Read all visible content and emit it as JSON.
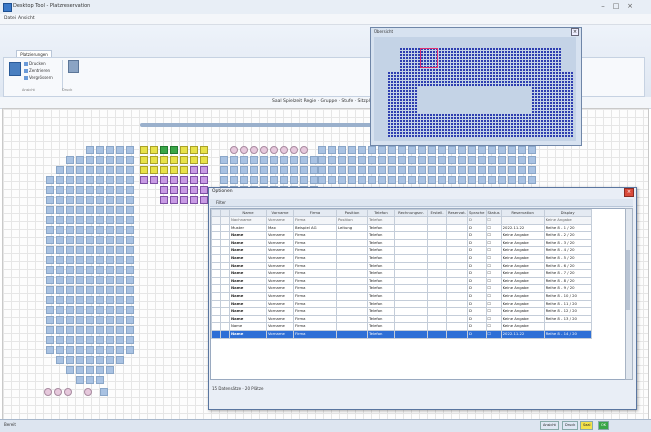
{
  "window": {
    "title": "Desktop Tool - Platzreservation",
    "controls": [
      "–",
      "□",
      "×"
    ]
  },
  "menu": {
    "items": [
      "Datei",
      "Ansicht"
    ]
  },
  "ribbon": {
    "tab": "Platzierungen",
    "small_buttons": [
      "Drucken",
      "Zentrieren",
      "Vergrössern"
    ],
    "groups": [
      "Ansicht",
      "Druck"
    ]
  },
  "strip": {
    "text": "Saal Spielzeit Regie · Gruppe · Stufe · Sitzplätze"
  },
  "overview": {
    "title": "Übersicht",
    "close": "×"
  },
  "dialog": {
    "title": "Optionen",
    "close": "×",
    "toolbar_label": "Filter",
    "columns": [
      "",
      "",
      "Name",
      "Vorname",
      "Firma",
      "Position",
      "Telefon",
      "Rechnungsnr.",
      "Erstell.",
      "Reservat.",
      "Sprache",
      "Status",
      "Reservation",
      "Display"
    ],
    "rows": [
      {
        "mark": "",
        "ico": "",
        "name": "Nachname",
        "vorname": "Vorname",
        "firma": "Firma",
        "position": "Position",
        "telefon": "Telefon",
        "r1": "",
        "r2": "",
        "r3": "",
        "sprache": "D",
        "status": "☐",
        "reservation": "",
        "display": "Keine Angabe",
        "bold": false,
        "filter": true
      },
      {
        "mark": "",
        "ico": "",
        "name": "Muster",
        "vorname": "Max",
        "firma": "Beispiel AG",
        "position": "Leitung",
        "telefon": "Telefon",
        "r1": "",
        "r2": "",
        "r3": "",
        "sprache": "D",
        "status": "☐",
        "reservation": "2022.11.22",
        "display": "Reihe 8 - 1 / 20",
        "bold": false,
        "filter": false
      },
      {
        "mark": "",
        "ico": "",
        "name": "Name",
        "vorname": "Vorname",
        "firma": "Firma",
        "position": "",
        "telefon": "Telefon",
        "r1": "",
        "r2": "",
        "r3": "",
        "sprache": "D",
        "status": "☐",
        "reservation": "Keine Angabe",
        "display": "Reihe 8 - 2 / 20",
        "bold": true,
        "filter": false
      },
      {
        "mark": "",
        "ico": "",
        "name": "Name",
        "vorname": "Vorname",
        "firma": "Firma",
        "position": "",
        "telefon": "Telefon",
        "r1": "",
        "r2": "",
        "r3": "",
        "sprache": "D",
        "status": "☐",
        "reservation": "Keine Angabe",
        "display": "Reihe 8 - 3 / 20",
        "bold": true,
        "filter": false
      },
      {
        "mark": "",
        "ico": "",
        "name": "Name",
        "vorname": "Vorname",
        "firma": "Firma",
        "position": "",
        "telefon": "Telefon",
        "r1": "",
        "r2": "",
        "r3": "",
        "sprache": "D",
        "status": "☐",
        "reservation": "Keine Angabe",
        "display": "Reihe 8 - 4 / 20",
        "bold": true,
        "filter": false
      },
      {
        "mark": "",
        "ico": "",
        "name": "Name",
        "vorname": "Vorname",
        "firma": "Firma",
        "position": "",
        "telefon": "Telefon",
        "r1": "",
        "r2": "",
        "r3": "",
        "sprache": "D",
        "status": "☐",
        "reservation": "Keine Angabe",
        "display": "Reihe 8 - 5 / 20",
        "bold": true,
        "filter": false
      },
      {
        "mark": "",
        "ico": "",
        "name": "Name",
        "vorname": "Vorname",
        "firma": "Firma",
        "position": "",
        "telefon": "Telefon",
        "r1": "",
        "r2": "",
        "r3": "",
        "sprache": "D",
        "status": "☐",
        "reservation": "Keine Angabe",
        "display": "Reihe 8 - 6 / 20",
        "bold": true,
        "filter": false
      },
      {
        "mark": "",
        "ico": "",
        "name": "Name",
        "vorname": "Vorname",
        "firma": "Firma",
        "position": "",
        "telefon": "Telefon",
        "r1": "",
        "r2": "",
        "r3": "",
        "sprache": "D",
        "status": "☐",
        "reservation": "Keine Angabe",
        "display": "Reihe 8 - 7 / 20",
        "bold": true,
        "filter": false
      },
      {
        "mark": "",
        "ico": "",
        "name": "Name",
        "vorname": "Vorname",
        "firma": "Firma",
        "position": "",
        "telefon": "Telefon",
        "r1": "",
        "r2": "",
        "r3": "",
        "sprache": "D",
        "status": "☐",
        "reservation": "Keine Angabe",
        "display": "Reihe 8 - 8 / 20",
        "bold": true,
        "filter": false
      },
      {
        "mark": "",
        "ico": "",
        "name": "Name",
        "vorname": "Vorname",
        "firma": "Firma",
        "position": "",
        "telefon": "Telefon",
        "r1": "",
        "r2": "",
        "r3": "",
        "sprache": "D",
        "status": "☐",
        "reservation": "Keine Angabe",
        "display": "Reihe 8 - 9 / 20",
        "bold": true,
        "filter": false
      },
      {
        "mark": "",
        "ico": "",
        "name": "Name",
        "vorname": "Vorname",
        "firma": "Firma",
        "position": "",
        "telefon": "Telefon",
        "r1": "",
        "r2": "",
        "r3": "",
        "sprache": "D",
        "status": "☐",
        "reservation": "Keine Angabe",
        "display": "Reihe 8 - 10 / 20",
        "bold": true,
        "filter": false
      },
      {
        "mark": "",
        "ico": "",
        "name": "Name",
        "vorname": "Vorname",
        "firma": "Firma",
        "position": "",
        "telefon": "Telefon",
        "r1": "",
        "r2": "",
        "r3": "",
        "sprache": "D",
        "status": "☐",
        "reservation": "Keine Angabe",
        "display": "Reihe 8 - 11 / 20",
        "bold": true,
        "filter": false
      },
      {
        "mark": "",
        "ico": "",
        "name": "Name",
        "vorname": "Vorname",
        "firma": "Firma",
        "position": "",
        "telefon": "Telefon",
        "r1": "",
        "r2": "",
        "r3": "",
        "sprache": "D",
        "status": "☐",
        "reservation": "Keine Angabe",
        "display": "Reihe 8 - 12 / 20",
        "bold": true,
        "filter": false
      },
      {
        "mark": "",
        "ico": "",
        "name": "Name",
        "vorname": "Vorname",
        "firma": "Firma",
        "position": "",
        "telefon": "Telefon",
        "r1": "",
        "r2": "",
        "r3": "",
        "sprache": "D",
        "status": "☐",
        "reservation": "Keine Angabe",
        "display": "Reihe 8 - 13 / 20",
        "bold": true,
        "filter": false
      },
      {
        "mark": "",
        "ico": "",
        "name": "Name",
        "vorname": "Vorname",
        "firma": "Firma",
        "position": "",
        "telefon": "Telefon",
        "r1": "",
        "r2": "",
        "r3": "",
        "sprache": "D",
        "status": "☐",
        "reservation": "Keine Angabe",
        "display": "",
        "bold": false,
        "filter": false
      },
      {
        "mark": "",
        "ico": "",
        "name": "Name",
        "vorname": "Vorname",
        "firma": "Firma",
        "position": "",
        "telefon": "Telefon",
        "r1": "",
        "r2": "",
        "r3": "",
        "sprache": "D",
        "status": "☐",
        "reservation": "2022.11.22",
        "display": "Reihe 8 - 14 / 20",
        "bold": true,
        "filter": false,
        "selected": true
      }
    ],
    "status": "15 Datensätze · 20 Plätze"
  },
  "statusbar": {
    "text": "Bereit",
    "buttons": [
      "Ansicht",
      "Druck",
      "Saal",
      "OK"
    ]
  },
  "colors": {
    "seat_blue": "#a9c2e2",
    "seat_yellow": "#e8e24a",
    "seat_green": "#3aa648",
    "seat_purple": "#c89ae4",
    "selection": "#2e6fd6",
    "minimap_seat": "#2e3eb0"
  }
}
